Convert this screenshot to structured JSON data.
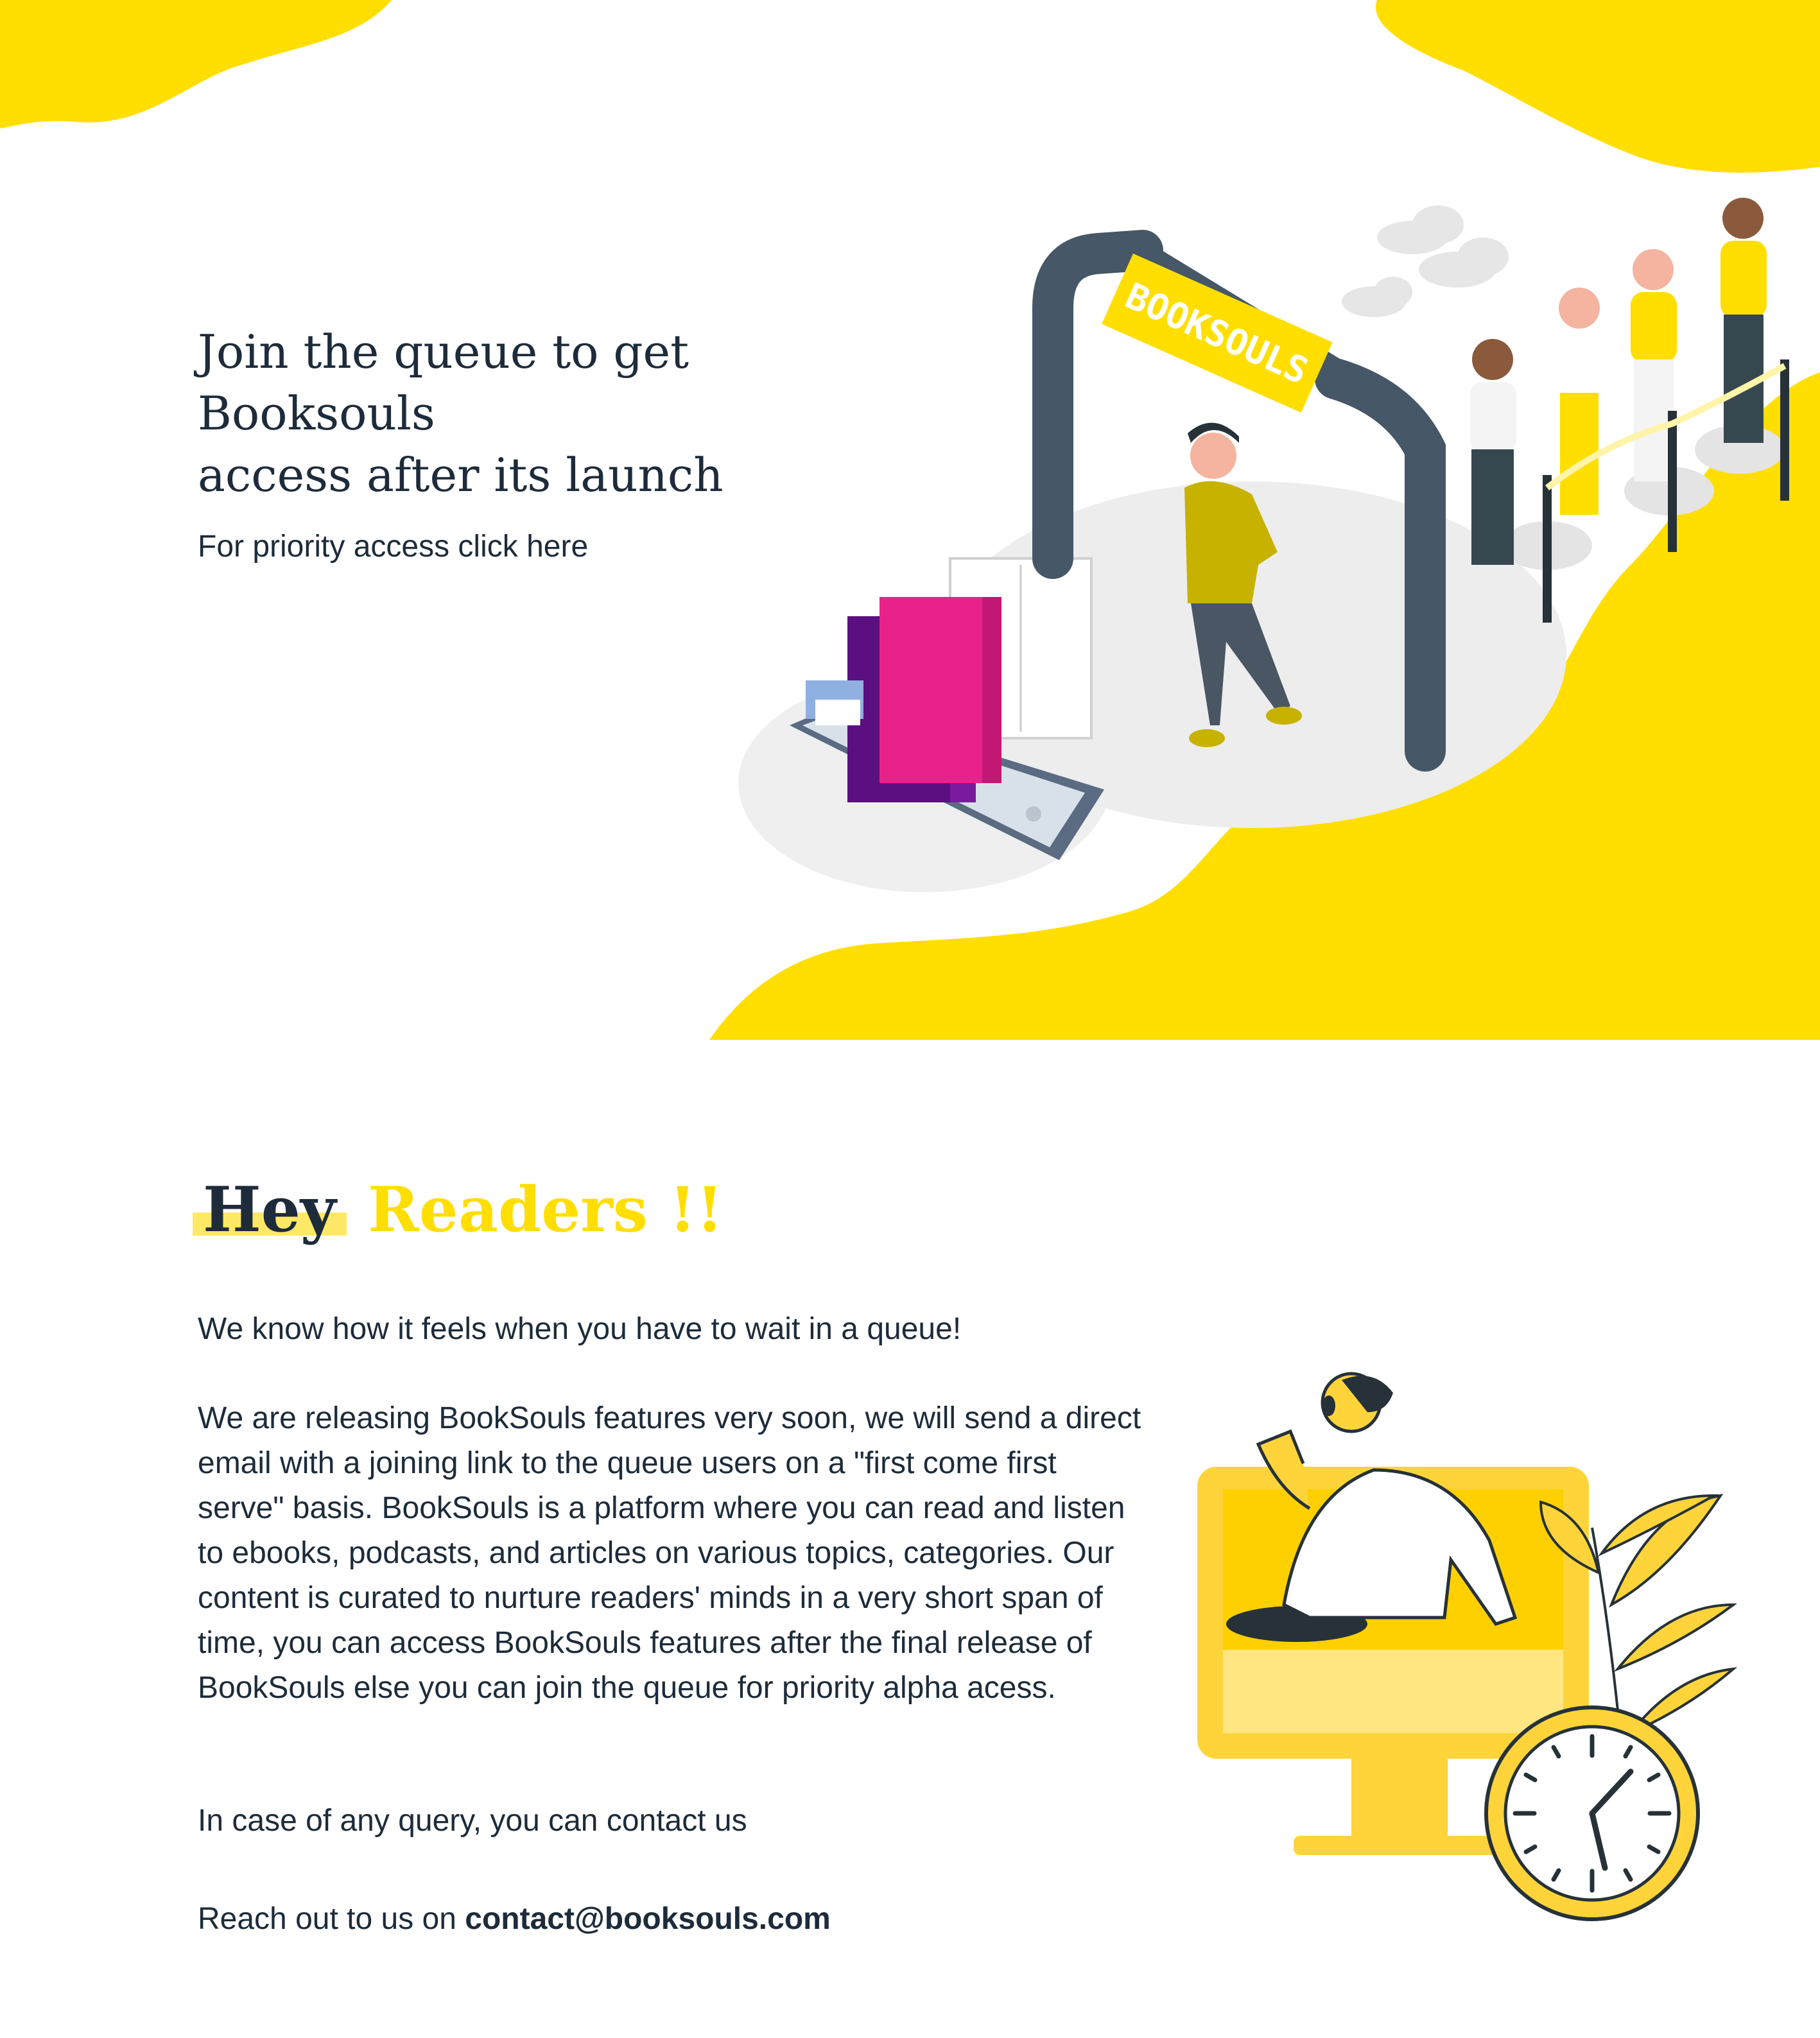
{
  "hero": {
    "title_line1": "Join the queue to get Booksouls",
    "title_line2": "access after its launch",
    "priority_link": "For priority access click here",
    "arch_sign": "BOOKSOULS"
  },
  "readers": {
    "heading_prefix": "Hey",
    "heading_accent": "Readers !!",
    "intro": "We know how it feels when you have to wait in a queue!",
    "body": "We are releasing BookSouls features very soon, we will send a direct email with a joining link to the queue users on a \"first come first serve\" basis. BookSouls is a platform where you can read and listen to ebooks, podcasts, and articles on various topics, categories. Our content is curated to nurture readers' minds in a very short span of time, you can access BookSouls features after the final release of BookSouls else you can join the queue for priority alpha acess.",
    "query": "In case of any query, you can contact us",
    "reach_prefix": "Reach out to us on",
    "email": "contact@booksouls.com"
  },
  "colors": {
    "accent": "#ffde00",
    "text": "#1d2b3a",
    "highlight": "#ffe866"
  }
}
